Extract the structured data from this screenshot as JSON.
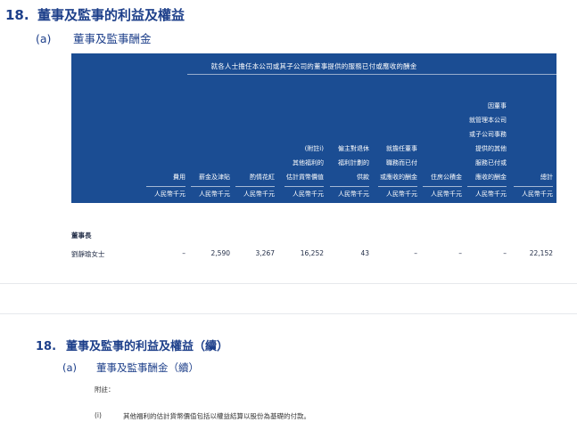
{
  "section1": {
    "number": "18.",
    "title": "董事及監事的利益及權益"
  },
  "sub1": {
    "label": "(a)",
    "title": "董事及監事酬金"
  },
  "table": {
    "band_title": "就各人士擔任本公司或其子公司的董事提供的服務已付或應收的酬金",
    "columns": [
      {
        "lines": [
          "費用"
        ],
        "unit": "人民幣千元"
      },
      {
        "lines": [
          "薪金及津貼"
        ],
        "unit": "人民幣千元"
      },
      {
        "lines": [
          "酌情花紅"
        ],
        "unit": "人民幣千元"
      },
      {
        "lines": [
          "(附註i)",
          "其他福利的",
          "估計貨幣價值"
        ],
        "unit": "人民幣千元"
      },
      {
        "lines": [
          "僱主對退休",
          "福利計劃的",
          "供款"
        ],
        "unit": "人民幣千元"
      },
      {
        "lines": [
          "就擔任董事",
          "職務而已付",
          "或應收的酬金"
        ],
        "unit": "人民幣千元"
      },
      {
        "lines": [
          "住房公積金"
        ],
        "unit": "人民幣千元"
      },
      {
        "lines": [
          "因董事",
          "就管理本公司",
          "或子公司事務",
          "提供的其他",
          "服務已付或",
          "應收的酬金"
        ],
        "unit": "人民幣千元"
      },
      {
        "lines": [
          "總計"
        ],
        "unit": "人民幣千元"
      }
    ],
    "category": "董事長",
    "rows": [
      {
        "name": "劉靜瑜女士",
        "values": [
          "–",
          "2,590",
          "3,267",
          "16,252",
          "43",
          "–",
          "–",
          "–",
          "22,152"
        ]
      }
    ]
  },
  "section2": {
    "number": "18.",
    "title": "董事及監事的利益及權益（續）"
  },
  "sub2": {
    "label": "(a)",
    "title": "董事及監事酬金（續）"
  },
  "notes": {
    "label": "附註：",
    "items": [
      {
        "mark": "(i)",
        "text": "其他福利的估計貨幣價值包括以權益結算以股份為基礎的付款。"
      }
    ]
  }
}
